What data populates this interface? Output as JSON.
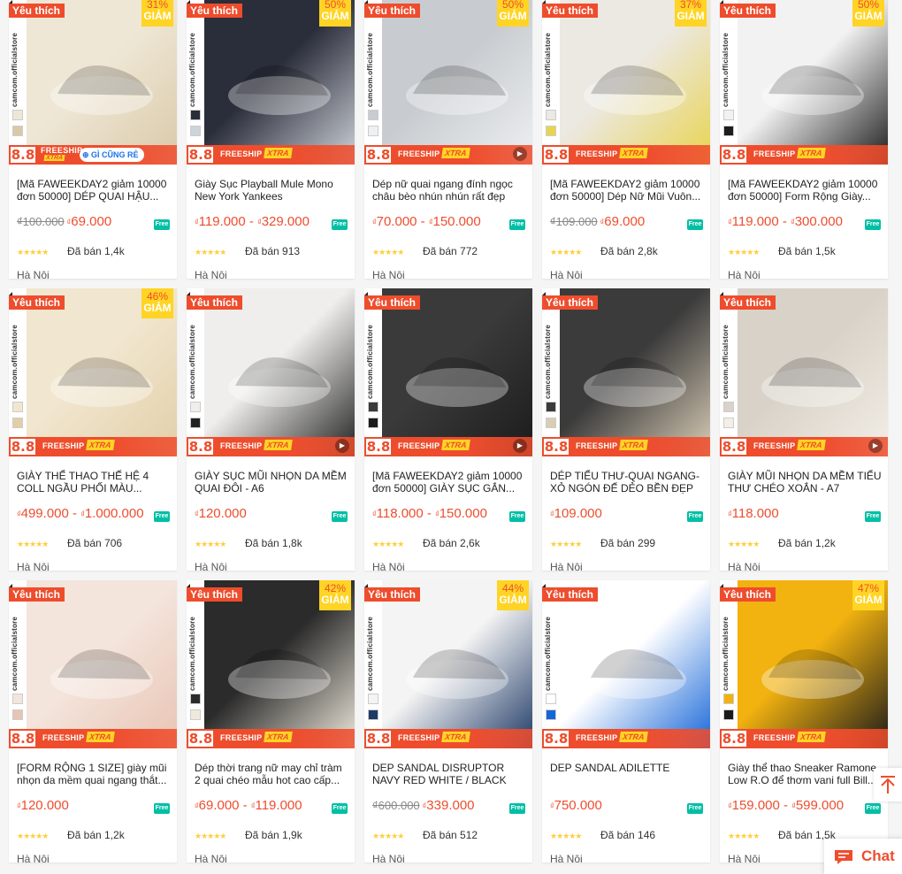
{
  "labels": {
    "favorite": "Yêu thích",
    "discount_off": "GIẢM",
    "promo_number": "8.8",
    "freeship": "FREESHIP",
    "xtra": "XTRA",
    "free_badge": "Free",
    "sold_prefix": "Đã bán",
    "currency": "₫",
    "brand_vertical": "camcom.officialstore",
    "extra_badge": "GÌ CŨNG RẺ"
  },
  "products": [
    {
      "name": "[Mã FAWEEKDAY2 giảm 10000 đơn 50000] DÉP QUAI HẬU...",
      "old_price": "₫100.000",
      "price": "69.000",
      "price_max": "",
      "sold": "1,4k",
      "location": "Hà Nội",
      "discount": "31%",
      "favorite": true,
      "video": false,
      "promo_style": "alt",
      "img_colors": [
        "#efe7d6",
        "#d9c9a8"
      ]
    },
    {
      "name": "Giày Sục Playball Mule Mono New York Yankees",
      "old_price": "",
      "price": "119.000",
      "price_max": "329.000",
      "sold": "913",
      "location": "Hà Nội",
      "discount": "50%",
      "favorite": true,
      "video": false,
      "promo_style": "std",
      "img_colors": [
        "#2a2d3a",
        "#cfd3da"
      ]
    },
    {
      "name": "Dép nữ quai ngang đính ngọc châu bèo nhún nhún rất đẹp",
      "old_price": "",
      "price": "70.000",
      "price_max": "150.000",
      "sold": "772",
      "location": "Hà Nội",
      "discount": "50%",
      "favorite": true,
      "video": true,
      "promo_style": "std",
      "img_colors": [
        "#c8ccd0",
        "#eef0f2"
      ]
    },
    {
      "name": "[Mã FAWEEKDAY2 giảm 10000 đơn 50000] Dép Nữ Mũi Vuôn...",
      "old_price": "₫109.000",
      "price": "69.000",
      "price_max": "",
      "sold": "2,8k",
      "location": "Hà Nội",
      "discount": "37%",
      "favorite": true,
      "video": false,
      "promo_style": "std",
      "img_colors": [
        "#ece8e2",
        "#e8d44f"
      ]
    },
    {
      "name": "[Mã FAWEEKDAY2 giảm 10000 đơn 50000] Form Rộng Giày...",
      "old_price": "",
      "price": "119.000",
      "price_max": "300.000",
      "sold": "1,5k",
      "location": "Hà Nội",
      "discount": "50%",
      "favorite": true,
      "video": false,
      "promo_style": "std",
      "img_colors": [
        "#f2f2f2",
        "#1d1d1d"
      ]
    },
    {
      "name": "GIÀY THỂ THAO THẾ HỆ 4 COLL NGẦU PHỐI MÀU...",
      "old_price": "",
      "price": "499.000",
      "price_max": "1.000.000",
      "sold": "706",
      "location": "Hà Nội",
      "discount": "46%",
      "favorite": true,
      "video": false,
      "promo_style": "std",
      "img_colors": [
        "#f1e6cf",
        "#e2cfa8"
      ]
    },
    {
      "name": "GIÀY SỤC MŨI NHỌN DA MỀM QUAI ĐÔI - A6",
      "old_price": "",
      "price": "120.000",
      "price_max": "",
      "sold": "1,8k",
      "location": "Hà Nội",
      "discount": "",
      "favorite": true,
      "video": true,
      "promo_style": "std",
      "img_colors": [
        "#efeeec",
        "#222222"
      ]
    },
    {
      "name": "[Mã FAWEEKDAY2 giảm 10000 đơn 50000] GIÀY SỤC GẮN...",
      "old_price": "",
      "price": "118.000",
      "price_max": "150.000",
      "sold": "2,6k",
      "location": "Hà Nội",
      "discount": "",
      "favorite": true,
      "video": true,
      "promo_style": "std",
      "img_colors": [
        "#3a3a3a",
        "#1b1b1b"
      ]
    },
    {
      "name": "DÉP TIỂU THƯ-QUAI NGANG-XỎ NGÓN ĐẾ DẺO BỀN ĐẸP",
      "old_price": "",
      "price": "109.000",
      "price_max": "",
      "sold": "299",
      "location": "Hà Nội",
      "discount": "",
      "favorite": true,
      "video": false,
      "promo_style": "std",
      "img_colors": [
        "#3b3b3b",
        "#d9cdb6"
      ]
    },
    {
      "name": "GIÀY MŨI NHỌN DA MỀM TIỂU THƯ CHÉO XOẮN - A7",
      "old_price": "",
      "price": "118.000",
      "price_max": "",
      "sold": "1,2k",
      "location": "Hà Nội",
      "discount": "",
      "favorite": true,
      "video": true,
      "promo_style": "std",
      "img_colors": [
        "#d8d2c8",
        "#f3eee6"
      ]
    },
    {
      "name": "[FORM RỘNG 1 SIZE] giày mũi nhọn da mềm quai ngang thắt...",
      "old_price": "",
      "price": "120.000",
      "price_max": "",
      "sold": "1,2k",
      "location": "Hà Nội",
      "discount": "",
      "favorite": true,
      "video": false,
      "promo_style": "std",
      "img_colors": [
        "#f4e5dc",
        "#e8c4b4"
      ]
    },
    {
      "name": "Dép thời trang nữ may chỉ tràm 2 quai chéo mẫu hot cao cấp...",
      "old_price": "",
      "price": "69.000",
      "price_max": "119.000",
      "sold": "1,9k",
      "location": "Hà Nội",
      "discount": "42%",
      "favorite": true,
      "video": false,
      "promo_style": "std",
      "img_colors": [
        "#2b2b2b",
        "#efe9dc"
      ]
    },
    {
      "name": "DEP SANDAL DISRUPTOR NAVY RED WHITE / BLACK",
      "old_price": "₫600.000",
      "price": "339.000",
      "price_max": "",
      "sold": "512",
      "location": "Hà Nội",
      "discount": "44%",
      "favorite": true,
      "video": false,
      "promo_style": "std",
      "img_colors": [
        "#f4f4f4",
        "#1f3a66"
      ]
    },
    {
      "name": "DEP SANDAL ADILETTE",
      "old_price": "",
      "price": "750.000",
      "price_max": "",
      "sold": "146",
      "location": "Hà Nội",
      "discount": "",
      "favorite": true,
      "video": false,
      "promo_style": "std",
      "img_colors": [
        "#ffffff",
        "#1565d8"
      ]
    },
    {
      "name": "Giày thể thao Sneaker Ramone Low R.O để thơm vani full Bill...",
      "old_price": "",
      "price": "159.000",
      "price_max": "599.000",
      "sold": "1,5k",
      "location": "Hà Nội",
      "discount": "47%",
      "favorite": true,
      "video": false,
      "promo_style": "std",
      "img_colors": [
        "#f2b20f",
        "#1a1a1a"
      ]
    }
  ],
  "floating": {
    "chat_label": "Chat"
  }
}
